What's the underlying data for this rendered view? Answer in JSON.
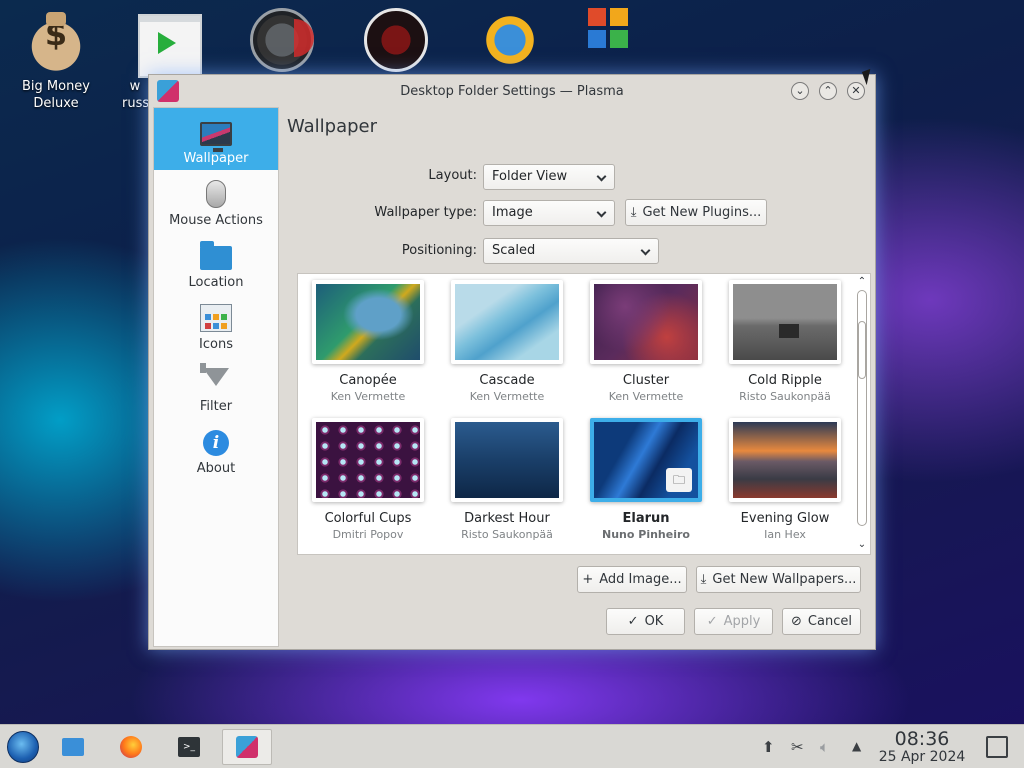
{
  "desktop": {
    "icons": [
      {
        "label": "Big Money Deluxe",
        "icon": "money-bag-icon"
      },
      {
        "label": "w russ",
        "icon": "video-player-icon"
      },
      {
        "label": "",
        "icon": "speedometer-icon"
      },
      {
        "label": "",
        "icon": "red-circle-game-icon"
      },
      {
        "label": "",
        "icon": "sun-globe-icon"
      },
      {
        "label": "",
        "icon": "office-suite-icon"
      }
    ]
  },
  "window": {
    "title": "Desktop Folder Settings — Plasma",
    "buttons": {
      "minimize": "⌄",
      "maximize": "⌃",
      "close": "✕"
    },
    "sidebar": [
      {
        "label": "Wallpaper",
        "icon": "monitor-icon",
        "active": true
      },
      {
        "label": "Mouse Actions",
        "icon": "mouse-icon"
      },
      {
        "label": "Location",
        "icon": "folder-icon"
      },
      {
        "label": "Icons",
        "icon": "icons-grid-icon"
      },
      {
        "label": "Filter",
        "icon": "funnel-icon"
      },
      {
        "label": "About",
        "icon": "info-icon"
      }
    ],
    "page_title": "Wallpaper",
    "layout": {
      "label": "Layout:",
      "value": "Folder View"
    },
    "wallpaper_type": {
      "label": "Wallpaper type:",
      "value": "Image"
    },
    "get_plugins_label": "Get New Plugins...",
    "positioning": {
      "label": "Positioning:",
      "value": "Scaled"
    },
    "wallpapers": [
      {
        "name": "Canopée",
        "author": "Ken Vermette"
      },
      {
        "name": "Cascade",
        "author": "Ken Vermette"
      },
      {
        "name": "Cluster",
        "author": "Ken Vermette"
      },
      {
        "name": "Cold Ripple",
        "author": "Risto Saukonpää"
      },
      {
        "name": "Colorful Cups",
        "author": "Dmitri Popov"
      },
      {
        "name": "Darkest Hour",
        "author": "Risto Saukonpää"
      },
      {
        "name": "Elarun",
        "author": "Nuno Pinheiro",
        "selected": true
      },
      {
        "name": "Evening Glow",
        "author": "Ian Hex"
      }
    ],
    "add_image_label": "Add Image...",
    "get_wallpapers_label": "Get New Wallpapers...",
    "ok_label": "OK",
    "apply_label": "Apply",
    "cancel_label": "Cancel"
  },
  "taskbar": {
    "time": "08:36",
    "date": "25 Apr 2024"
  }
}
